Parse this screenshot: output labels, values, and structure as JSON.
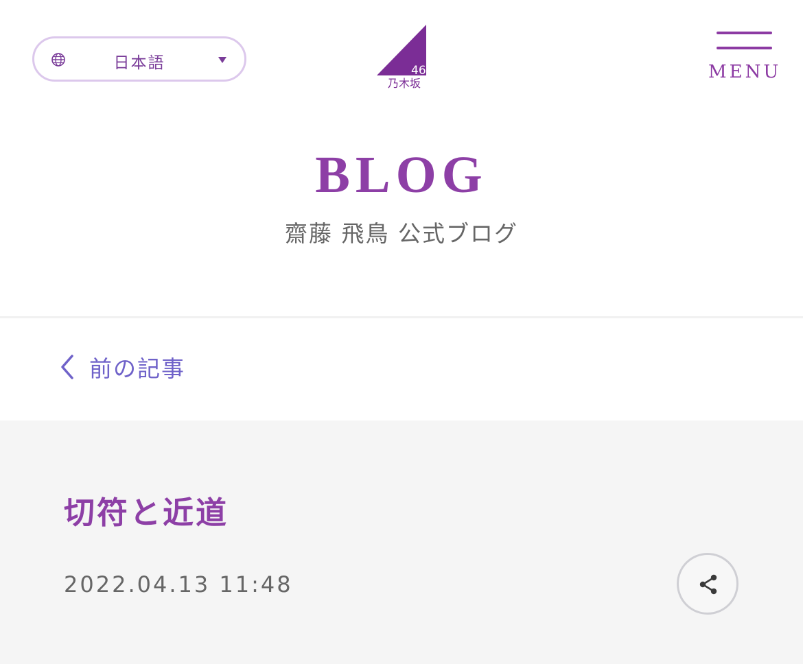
{
  "header": {
    "language": {
      "label": "日本語",
      "icon": "globe-icon",
      "caret_icon": "caret-down-icon"
    },
    "logo": {
      "text_number": "46",
      "text_name": "乃木坂",
      "color": "#7b2d96"
    },
    "menu": {
      "label": "MENU",
      "icon": "hamburger-icon"
    }
  },
  "page": {
    "section_title": "BLOG",
    "subtitle": "齋藤 飛鳥 公式ブログ"
  },
  "navigation": {
    "prev_label": "前の記事",
    "prev_icon": "chevron-left-icon"
  },
  "article": {
    "title": "切符と近道",
    "date": "2022.04.13 11:48",
    "share_icon": "share-icon"
  },
  "colors": {
    "accent": "#8d3fa6",
    "link": "#6f62c9",
    "panel_bg": "#f5f5f5"
  }
}
